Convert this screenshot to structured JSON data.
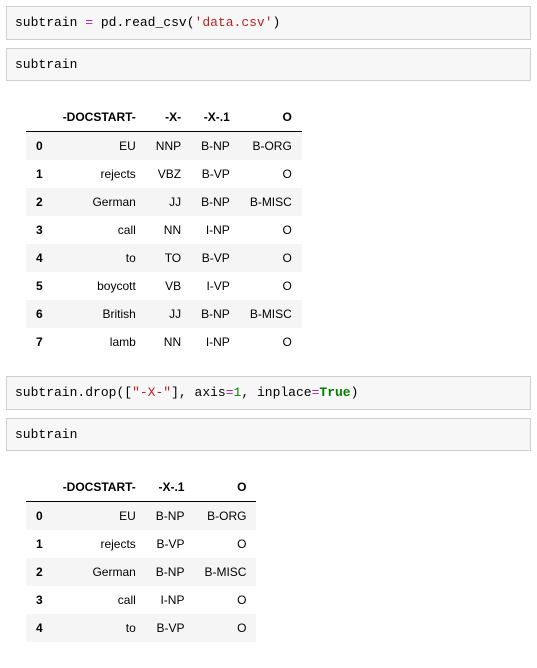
{
  "cells": {
    "code1": {
      "var1": "subtrain",
      "eqsp": " ",
      "op_eq": "=",
      "sp": " ",
      "mod": "pd",
      "dot": ".",
      "fn": "read_csv",
      "lp": "(",
      "str": "'data.csv'",
      "rp": ")"
    },
    "code2": {
      "var1": "subtrain"
    },
    "code3": {
      "var1": "subtrain",
      "dot": ".",
      "fn": "drop",
      "lp": "(",
      "lbr": "[",
      "str": "\"-X-\"",
      "rbr": "]",
      "c1": ",",
      "argtxt": " axis",
      "eq": "=",
      "num": "1",
      "c2": ",",
      "argtxt2": " inplace",
      "eq2": "=",
      "kw": "True",
      "rp": ")"
    },
    "code4": {
      "var1": "subtrain"
    }
  },
  "table1": {
    "columns": [
      "-DOCSTART-",
      "-X-",
      "-X-.1",
      "O"
    ],
    "rows": [
      {
        "idx": "0",
        "c": [
          "EU",
          "NNP",
          "B-NP",
          "B-ORG"
        ]
      },
      {
        "idx": "1",
        "c": [
          "rejects",
          "VBZ",
          "B-VP",
          "O"
        ]
      },
      {
        "idx": "2",
        "c": [
          "German",
          "JJ",
          "B-NP",
          "B-MISC"
        ]
      },
      {
        "idx": "3",
        "c": [
          "call",
          "NN",
          "I-NP",
          "O"
        ]
      },
      {
        "idx": "4",
        "c": [
          "to",
          "TO",
          "B-VP",
          "O"
        ]
      },
      {
        "idx": "5",
        "c": [
          "boycott",
          "VB",
          "I-VP",
          "O"
        ]
      },
      {
        "idx": "6",
        "c": [
          "British",
          "JJ",
          "B-NP",
          "B-MISC"
        ]
      },
      {
        "idx": "7",
        "c": [
          "lamb",
          "NN",
          "I-NP",
          "O"
        ]
      }
    ]
  },
  "table2": {
    "columns": [
      "-DOCSTART-",
      "-X-.1",
      "O"
    ],
    "rows": [
      {
        "idx": "0",
        "c": [
          "EU",
          "B-NP",
          "B-ORG"
        ]
      },
      {
        "idx": "1",
        "c": [
          "rejects",
          "B-VP",
          "O"
        ]
      },
      {
        "idx": "2",
        "c": [
          "German",
          "B-NP",
          "B-MISC"
        ]
      },
      {
        "idx": "3",
        "c": [
          "call",
          "I-NP",
          "O"
        ]
      },
      {
        "idx": "4",
        "c": [
          "to",
          "B-VP",
          "O"
        ]
      }
    ]
  }
}
